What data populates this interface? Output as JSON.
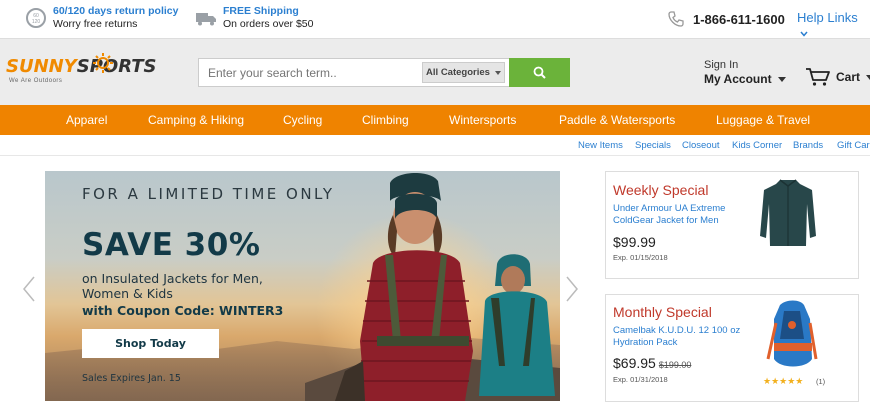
{
  "topbar": {
    "return_title": "60/120 days return policy",
    "return_sub": "Worry free returns",
    "shipping_title": "FREE Shipping",
    "shipping_sub": "On orders over $50",
    "phone": "1-866-611-1600",
    "help_links": "Help Links"
  },
  "header": {
    "logo_sunny": "SUNNY",
    "logo_sports": "SPORTS",
    "logo_tagline": "We Are Outdoors",
    "search_placeholder": "Enter your search term..",
    "category": "All Categories",
    "sign_in": "Sign In",
    "my_account": "My Account",
    "cart": "Cart"
  },
  "nav": {
    "items": [
      "Apparel",
      "Camping & Hiking",
      "Cycling",
      "Climbing",
      "Wintersports",
      "Paddle & Watersports",
      "Luggage & Travel"
    ]
  },
  "subnav": {
    "items": [
      "New Items",
      "Specials",
      "Closeout",
      "Kids Corner",
      "Brands",
      "Gift Car"
    ]
  },
  "hero": {
    "line1": "FOR A LIMITED TIME ONLY",
    "headline": "SAVE 30%",
    "sub": "on Insulated Jackets for Men, Women & Kids",
    "code": "with Coupon Code: WINTER3",
    "button": "Shop Today",
    "expires": "Sales Expires Jan. 15"
  },
  "specials": [
    {
      "title": "Weekly Special",
      "product": "Under Armour UA Extreme ColdGear Jacket for Men",
      "price": "$99.99",
      "old_price": "",
      "expires": "Exp. 01/15/2018"
    },
    {
      "title": "Monthly Special",
      "product": "Camelbak K.U.D.U. 12 100 oz Hydration Pack",
      "price": "$69.95",
      "old_price": "$199.00",
      "expires": "Exp. 01/31/2018",
      "stars": "★★★★★",
      "rating": 5,
      "review_count": "(1)"
    }
  ],
  "colors": {
    "accent_orange": "#ef8300",
    "link_blue": "#2b7fd0",
    "search_green": "#6bb33a",
    "special_red": "#c0392b"
  }
}
